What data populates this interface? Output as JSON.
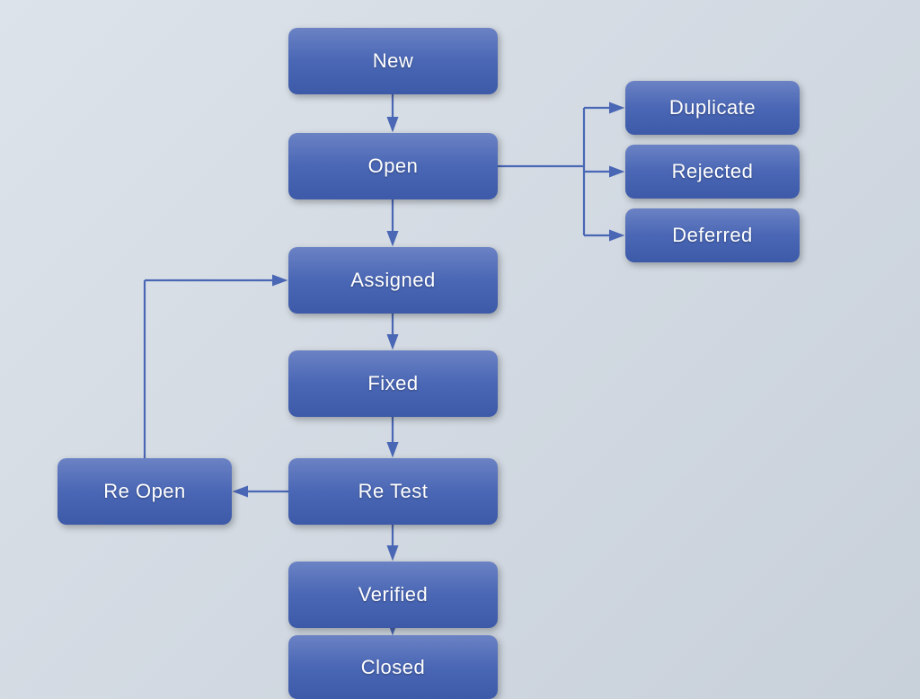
{
  "nodes": {
    "new": {
      "label": "New"
    },
    "open": {
      "label": "Open"
    },
    "assigned": {
      "label": "Assigned"
    },
    "fixed": {
      "label": "Fixed"
    },
    "retest": {
      "label": "Re Test"
    },
    "verified": {
      "label": "Verified"
    },
    "closed": {
      "label": "Closed"
    },
    "duplicate": {
      "label": "Duplicate"
    },
    "rejected": {
      "label": "Rejected"
    },
    "deferred": {
      "label": "Deferred"
    },
    "reopen": {
      "label": "Re Open"
    }
  }
}
